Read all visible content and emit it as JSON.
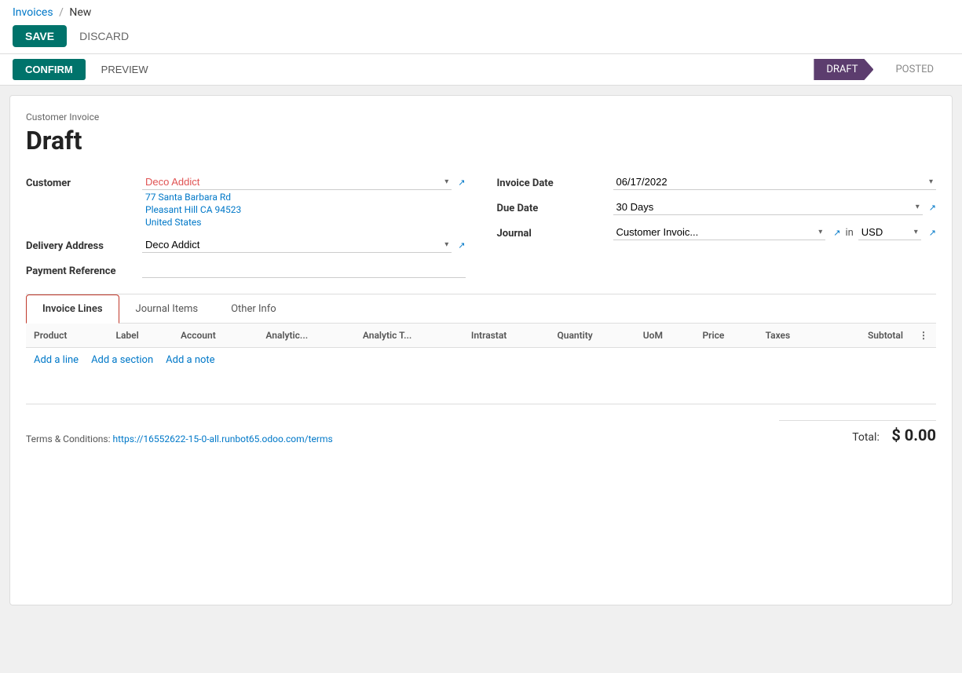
{
  "breadcrumb": {
    "parent": "Invoices",
    "separator": "/",
    "current": "New"
  },
  "toolbar": {
    "save_label": "SAVE",
    "discard_label": "DISCARD"
  },
  "actions": {
    "confirm_label": "CONFIRM",
    "preview_label": "PREVIEW"
  },
  "status_pipeline": [
    {
      "id": "draft",
      "label": "DRAFT",
      "active": true
    },
    {
      "id": "posted",
      "label": "POSTED",
      "active": false
    }
  ],
  "invoice": {
    "type_label": "Customer Invoice",
    "status_title": "Draft",
    "customer_label": "Customer",
    "customer_name": "Deco Addict",
    "customer_address_line1": "77 Santa Barbara Rd",
    "customer_address_line2": "Pleasant Hill CA 94523",
    "customer_address_line3": "United States",
    "delivery_address_label": "Delivery Address",
    "delivery_address_name": "Deco Addict",
    "payment_reference_label": "Payment Reference",
    "payment_reference_value": "",
    "invoice_date_label": "Invoice Date",
    "invoice_date_value": "06/17/2022",
    "due_date_label": "Due Date",
    "due_date_value": "30 Days",
    "journal_label": "Journal",
    "journal_value": "Customer Invoic...",
    "journal_currency_label": "in",
    "journal_currency_value": "USD"
  },
  "tabs": [
    {
      "id": "invoice-lines",
      "label": "Invoice Lines",
      "active": true
    },
    {
      "id": "journal-items",
      "label": "Journal Items",
      "active": false
    },
    {
      "id": "other-info",
      "label": "Other Info",
      "active": false
    }
  ],
  "table": {
    "columns": [
      {
        "id": "product",
        "label": "Product"
      },
      {
        "id": "label",
        "label": "Label"
      },
      {
        "id": "account",
        "label": "Account"
      },
      {
        "id": "analytic",
        "label": "Analytic..."
      },
      {
        "id": "analytic-t",
        "label": "Analytic T..."
      },
      {
        "id": "intrastat",
        "label": "Intrastat"
      },
      {
        "id": "quantity",
        "label": "Quantity"
      },
      {
        "id": "uom",
        "label": "UoM"
      },
      {
        "id": "price",
        "label": "Price"
      },
      {
        "id": "taxes",
        "label": "Taxes"
      },
      {
        "id": "subtotal",
        "label": "Subtotal"
      }
    ],
    "rows": [],
    "add_line_label": "Add a line",
    "add_section_label": "Add a section",
    "add_note_label": "Add a note"
  },
  "footer": {
    "terms_label": "Terms & Conditions:",
    "terms_link": "https://16552622-15-0-all.runbot65.odoo.com/terms",
    "total_label": "Total:",
    "total_amount": "$ 0.00"
  }
}
